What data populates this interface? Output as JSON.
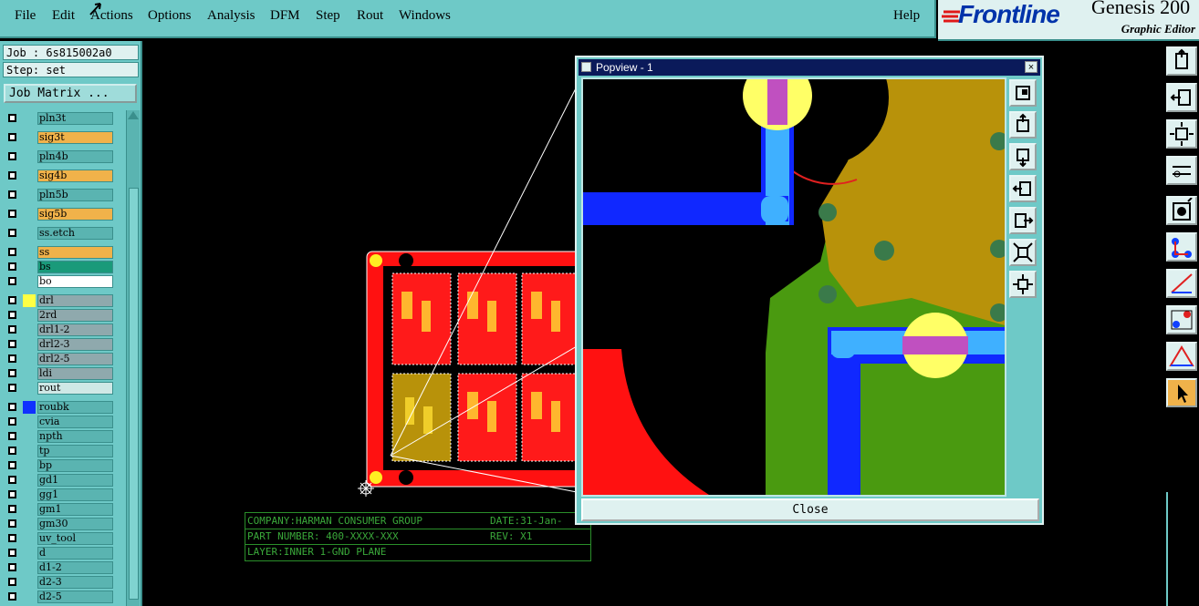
{
  "menu": {
    "file": "File",
    "edit": "Edit",
    "actions": "Actions",
    "options": "Options",
    "analysis": "Analysis",
    "dfm": "DFM",
    "step": "Step",
    "rout": "Rout",
    "windows": "Windows",
    "help": "Help"
  },
  "brand": {
    "logo": "Frontline",
    "product": "Genesis 200",
    "subtitle": "Graphic Editor"
  },
  "job": {
    "job_line": "Job : 6s815002a0",
    "step_line": "Step: set",
    "matrix_button": "Job Matrix ..."
  },
  "layers": [
    {
      "name": "pln3t",
      "color": "#5ab4b1",
      "swatch": ""
    },
    {
      "name": "sig3t",
      "color": "#f0b24a",
      "swatch": ""
    },
    {
      "name": "pln4b",
      "color": "#5ab4b1",
      "swatch": ""
    },
    {
      "name": "sig4b",
      "color": "#f0b24a",
      "swatch": ""
    },
    {
      "name": "pln5b",
      "color": "#5ab4b1",
      "swatch": ""
    },
    {
      "name": "sig5b",
      "color": "#f0b24a",
      "swatch": ""
    },
    {
      "name": "ss.etch",
      "color": "#5ab4b1",
      "swatch": ""
    },
    {
      "name": "ss",
      "color": "#f0b24a",
      "swatch": ""
    },
    {
      "name": "bs",
      "color": "#1a9a7a",
      "swatch": ""
    },
    {
      "name": "bo",
      "color": "#ffffff",
      "swatch": ""
    },
    {
      "name": "drl",
      "color": "#8fa9ad",
      "swatch": "#ffff44"
    },
    {
      "name": "2rd",
      "color": "#8fa9ad",
      "swatch": ""
    },
    {
      "name": "drl1-2",
      "color": "#8fa9ad",
      "swatch": ""
    },
    {
      "name": "drl2-3",
      "color": "#8fa9ad",
      "swatch": ""
    },
    {
      "name": "drl2-5",
      "color": "#8fa9ad",
      "swatch": ""
    },
    {
      "name": "ldi",
      "color": "#8fa9ad",
      "swatch": ""
    },
    {
      "name": "rout",
      "color": "#cfe8e6",
      "swatch": ""
    },
    {
      "name": "roubk",
      "color": "#5ab4b1",
      "swatch": "#1030ff"
    },
    {
      "name": "cvia",
      "color": "#5ab4b1",
      "swatch": ""
    },
    {
      "name": "npth",
      "color": "#5ab4b1",
      "swatch": ""
    },
    {
      "name": "tp",
      "color": "#5ab4b1",
      "swatch": ""
    },
    {
      "name": "bp",
      "color": "#5ab4b1",
      "swatch": ""
    },
    {
      "name": "gd1",
      "color": "#5ab4b1",
      "swatch": ""
    },
    {
      "name": "gg1",
      "color": "#5ab4b1",
      "swatch": ""
    },
    {
      "name": "gm1",
      "color": "#5ab4b1",
      "swatch": ""
    },
    {
      "name": "gm30",
      "color": "#5ab4b1",
      "swatch": ""
    },
    {
      "name": "uv_tool",
      "color": "#5ab4b1",
      "swatch": ""
    },
    {
      "name": "d",
      "color": "#5ab4b1",
      "swatch": ""
    },
    {
      "name": "d1-2",
      "color": "#5ab4b1",
      "swatch": ""
    },
    {
      "name": "d2-3",
      "color": "#5ab4b1",
      "swatch": ""
    },
    {
      "name": "d2-5",
      "color": "#5ab4b1",
      "swatch": ""
    }
  ],
  "popview": {
    "title": "Popview - 1",
    "close_x": "×",
    "close_button": "Close"
  },
  "titleblock": {
    "company": "COMPANY:HARMAN CONSUMER GROUP",
    "date": "DATE:31-Jan-",
    "part": "PART NUMBER: 400-XXXX-XXX",
    "rev": "REV: X1",
    "layer": "LAYER:INNER 1-GND PLANE"
  },
  "colors": {
    "panel": "#6ec9c7",
    "accent": "#3a8f8c",
    "board_red": "#ff1111",
    "copper": "#b8920a"
  }
}
